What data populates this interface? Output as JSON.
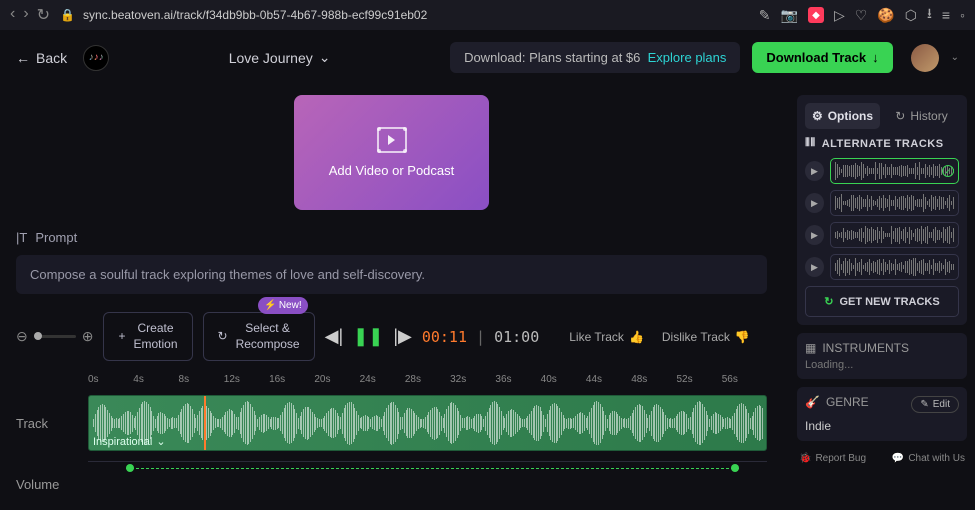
{
  "browser": {
    "url": "sync.beatoven.ai/track/f34db9bb-0b57-4b67-988b-ecf99c91eb02"
  },
  "header": {
    "back": "Back",
    "title": "Love Journey",
    "download_prefix": "Download: Plans starting at $6",
    "explore": "Explore plans",
    "download_cta": "Download Track"
  },
  "upload": {
    "label": "Add Video or Podcast"
  },
  "prompt": {
    "label": "Prompt",
    "text": "Compose a soulful track exploring themes of love and self-discovery."
  },
  "controls": {
    "create_emotion": "Create\nEmotion",
    "select_recompose": "Select &\nRecompose",
    "new_badge": "New!",
    "time_current": "00:11",
    "time_total": "01:00",
    "like": "Like Track",
    "dislike": "Dislike Track"
  },
  "timeline": {
    "ticks": [
      "0s",
      "4s",
      "8s",
      "12s",
      "16s",
      "20s",
      "24s",
      "28s",
      "32s",
      "36s",
      "40s",
      "44s",
      "48s",
      "52s",
      "56s"
    ],
    "track_label": "Track",
    "emotion_tag": "Inspirational",
    "volume_label": "Volume",
    "playhead_percent": 17
  },
  "panel": {
    "options_tab": "Options",
    "history_tab": "History",
    "alt_header": "ALTERNATE TRACKS",
    "get_new": "GET NEW TRACKS",
    "instruments_title": "INSTRUMENTS",
    "instruments_loading": "Loading...",
    "genre_title": "GENRE",
    "edit": "Edit",
    "genre_value": "Indie",
    "report": "Report Bug",
    "chat": "Chat with Us"
  }
}
